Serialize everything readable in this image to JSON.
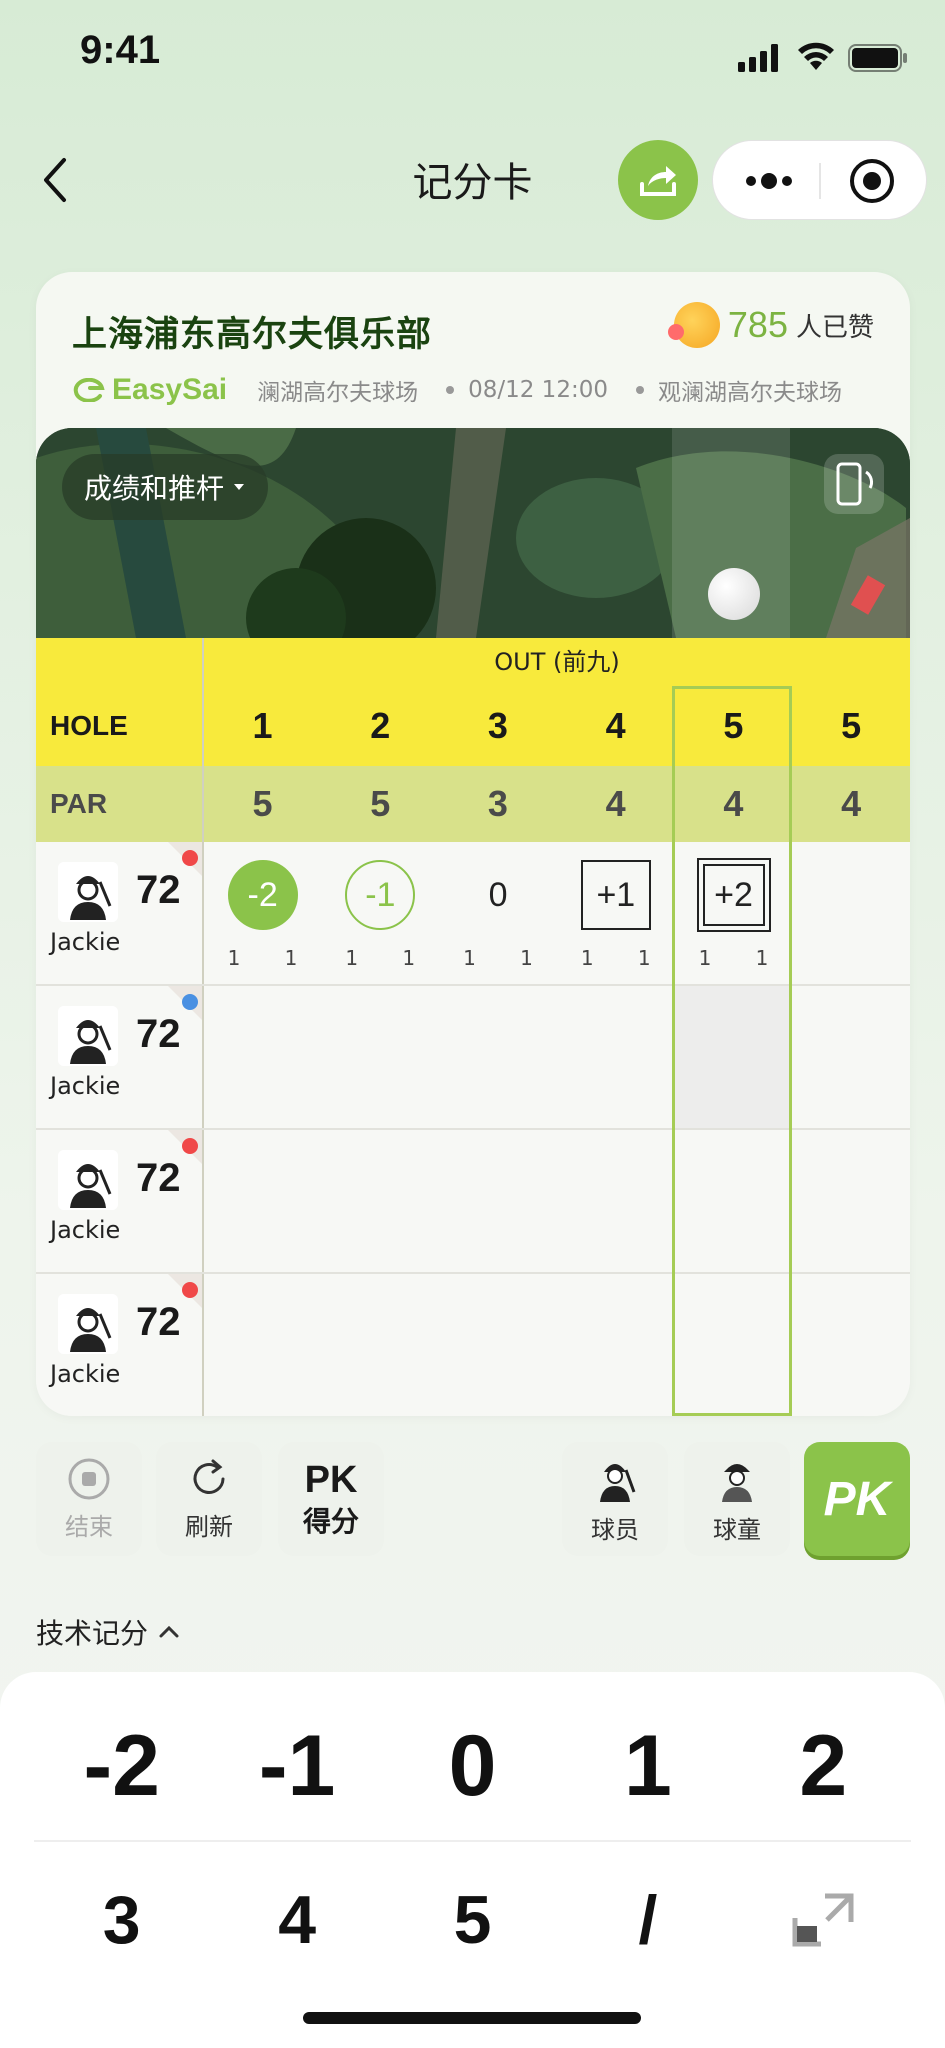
{
  "status_bar": {
    "time": "9:41"
  },
  "nav": {
    "title": "记分卡"
  },
  "card": {
    "club_name": "上海浦东高尔夫俱乐部",
    "likes_count": "785",
    "likes_label": "人已赞",
    "brand": "EasySai",
    "course_left": "澜湖高尔夫球场",
    "datetime": "08/12 12:00",
    "course_right": "观澜湖高尔夫球场",
    "map_toggle": "成绩和推杆"
  },
  "table": {
    "out_label": "OUT (前九)",
    "hole_label": "HOLE",
    "par_label": "PAR",
    "holes": [
      "1",
      "2",
      "3",
      "4",
      "5",
      "5"
    ],
    "pars": [
      "5",
      "5",
      "3",
      "4",
      "4",
      "4"
    ],
    "players": [
      {
        "name": "Jackie",
        "total": "72",
        "dot_color": "#f04848",
        "scores": [
          "-2",
          "-1",
          "0",
          "+1",
          "+2",
          ""
        ],
        "marks": [
          "eagle",
          "birdie",
          "par",
          "bogey",
          "double",
          "none"
        ],
        "stats": [
          [
            "1",
            "1"
          ],
          [
            "1",
            "1"
          ],
          [
            "1",
            "1"
          ],
          [
            "1",
            "1"
          ],
          [
            "1",
            "1"
          ],
          [
            "",
            ""
          ]
        ]
      },
      {
        "name": "Jackie",
        "total": "72",
        "dot_color": "#4a90e2"
      },
      {
        "name": "Jackie",
        "total": "72",
        "dot_color": "#f04848"
      },
      {
        "name": "Jackie",
        "total": "72",
        "dot_color": "#f04848"
      }
    ]
  },
  "toolbar": {
    "end_label": "结束",
    "refresh_label": "刷新",
    "pk_score_top": "PK",
    "pk_score_bottom": "得分",
    "player_label": "球员",
    "caddie_label": "球童",
    "pk_main": "PK"
  },
  "tech_score_label": "技术记分",
  "keypad": {
    "row1": [
      "-2",
      "-1",
      "0",
      "1",
      "2"
    ],
    "row2": [
      "3",
      "4",
      "5",
      "/"
    ]
  },
  "colors": {
    "accent": "#8bc34a",
    "yellow": "#f8ea3c",
    "par_row": "#d8e18a"
  }
}
